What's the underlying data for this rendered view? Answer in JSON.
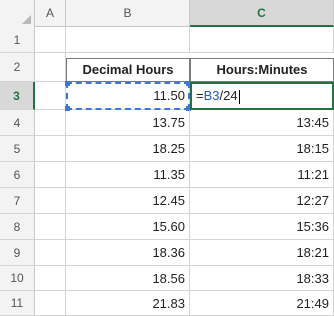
{
  "columns": [
    {
      "label": "",
      "name": "col-header-corner"
    },
    {
      "label": "A",
      "name": "col-header-a"
    },
    {
      "label": "B",
      "name": "col-header-b"
    },
    {
      "label": "C",
      "name": "col-header-c"
    }
  ],
  "rows": [
    "1",
    "2",
    "3",
    "4",
    "5",
    "6",
    "7",
    "8",
    "9",
    "10",
    "11"
  ],
  "table": {
    "header_decimal": "Decimal Hours",
    "header_time": "Hours:Minutes",
    "edit_formula_prefix": "=",
    "edit_formula_ref": "B3",
    "edit_formula_suffix": "/24",
    "data": [
      {
        "decimal": "11.50",
        "time": ""
      },
      {
        "decimal": "13.75",
        "time": "13:45"
      },
      {
        "decimal": "18.25",
        "time": "18:15"
      },
      {
        "decimal": "11.35",
        "time": "11:21"
      },
      {
        "decimal": "12.45",
        "time": "12:27"
      },
      {
        "decimal": "15.60",
        "time": "15:36"
      },
      {
        "decimal": "18.36",
        "time": "18:21"
      },
      {
        "decimal": "18.56",
        "time": "18:33"
      },
      {
        "decimal": "21.83",
        "time": "21:49"
      }
    ]
  },
  "colors": {
    "accent": "#217346",
    "reference": "#3c78d8"
  }
}
